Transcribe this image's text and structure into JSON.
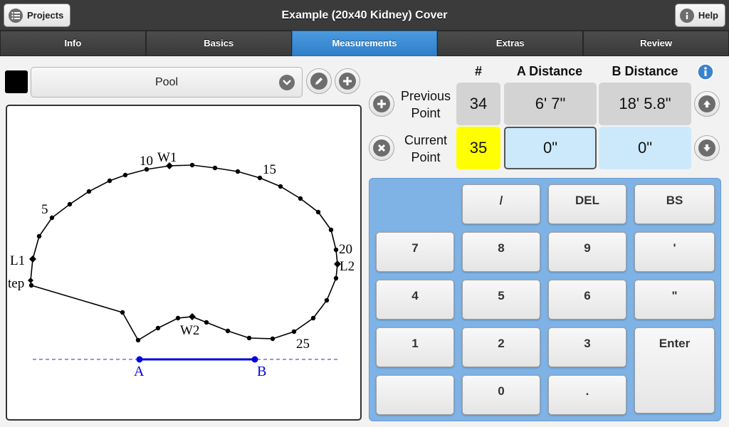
{
  "header": {
    "title": "Example (20x40 Kidney) Cover",
    "projects_label": "Projects",
    "help_label": "Help"
  },
  "tabs": [
    {
      "label": "Info",
      "active": false
    },
    {
      "label": "Basics",
      "active": false
    },
    {
      "label": "Measurements",
      "active": true
    },
    {
      "label": "Extras",
      "active": false
    },
    {
      "label": "Review",
      "active": false
    }
  ],
  "toolbar": {
    "color_swatch": "#000000",
    "selected_shape": "Pool",
    "icons": [
      "chevron-down-icon",
      "pencil-icon",
      "plus-icon"
    ]
  },
  "drawing": {
    "labels": {
      "p5": "5",
      "p10": "10",
      "p15": "15",
      "p20": "20",
      "p25": "25",
      "w1": "W1",
      "w2": "W2",
      "l1": "L1",
      "l2": "L2",
      "step": "tep",
      "a": "A",
      "b": "B"
    },
    "colors": {
      "outline": "#000000",
      "baseline": "#0000dd"
    }
  },
  "measure": {
    "headers": {
      "num": "#",
      "a": "A Distance",
      "b": "B Distance"
    },
    "previous": {
      "label_line1": "Previous",
      "label_line2": "Point",
      "num": "34",
      "a": "6' 7\"",
      "b": "18' 5.8\""
    },
    "current": {
      "label_line1": "Current",
      "label_line2": "Point",
      "num": "35",
      "a": "0\"",
      "b": "0\""
    },
    "colors": {
      "current_num_bg": "#ffff00",
      "current_val_bg": "#cce9fb",
      "prev_bg": "#d3d3d3"
    }
  },
  "keypad": {
    "keys": [
      "/",
      "DEL",
      "BS",
      "7",
      "8",
      "9",
      "'",
      "4",
      "5",
      "6",
      "\"",
      "1",
      "2",
      "3",
      "Enter",
      "0",
      "."
    ]
  }
}
